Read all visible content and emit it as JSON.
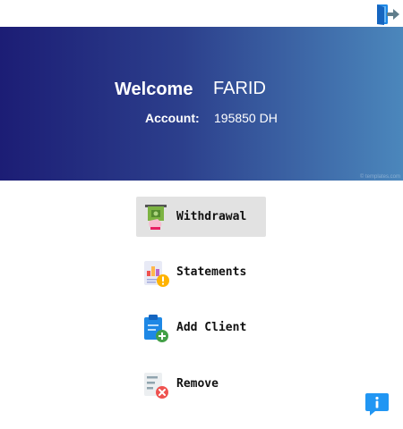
{
  "header": {
    "logout_icon": "logout-icon"
  },
  "banner": {
    "welcome_label": "Welcome",
    "user_name": "FARID",
    "account_label": "Account:",
    "account_value": "195850 DH",
    "watermark": "© templates.com",
    "gradient_colors": [
      "#1c1d75",
      "#4b87bc"
    ]
  },
  "menu": {
    "items": [
      {
        "label": "Withdrawal",
        "icon": "cash-withdrawal-icon",
        "selected": true
      },
      {
        "label": "Statements",
        "icon": "statements-icon",
        "selected": false
      },
      {
        "label": "Add Client",
        "icon": "add-client-icon",
        "selected": false
      },
      {
        "label": "Remove",
        "icon": "remove-icon",
        "selected": false
      }
    ]
  },
  "footer": {
    "info_icon": "info-icon",
    "accent_color": "#2196f3"
  }
}
